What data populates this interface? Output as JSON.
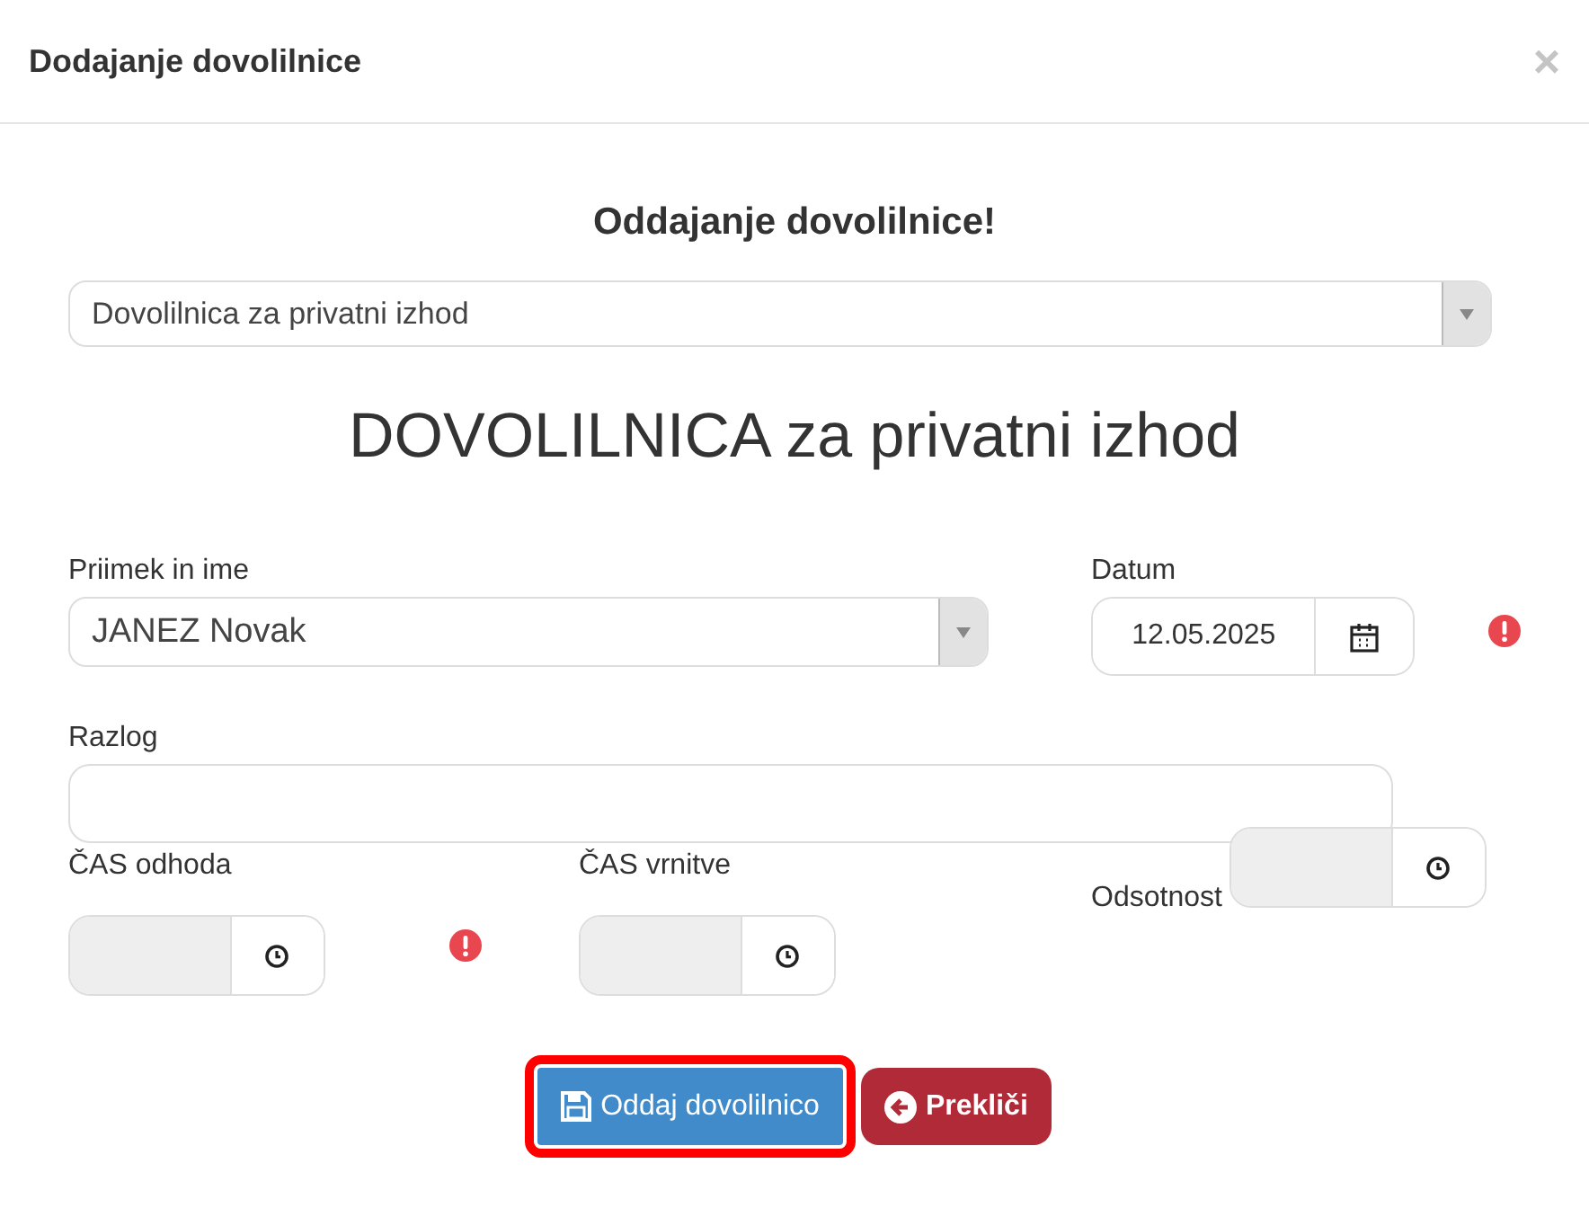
{
  "window": {
    "title": "Dodajanje dovolilnice",
    "close": "×"
  },
  "heading": "Oddajanje dovolilnice!",
  "type_select": {
    "value": "Dovolilnica za privatni izhod"
  },
  "form_title": "DOVOLILNICA za privatni izhod",
  "name_field": {
    "label": "Priimek in ime",
    "value": "JANEZ Novak"
  },
  "date_field": {
    "label": "Datum",
    "value": "12.05.2025",
    "error": true
  },
  "reason_field": {
    "label": "Razlog"
  },
  "departure_time": {
    "label": "ČAS odhoda",
    "error": true
  },
  "return_time": {
    "label": "ČAS vrnitve"
  },
  "absence": {
    "label": "Odsotnost"
  },
  "buttons": [
    {
      "kind": "save",
      "label": "Oddaj dovolilnico",
      "highlighted": true
    },
    {
      "kind": "back",
      "label": "Prekliči",
      "highlighted": false
    }
  ]
}
